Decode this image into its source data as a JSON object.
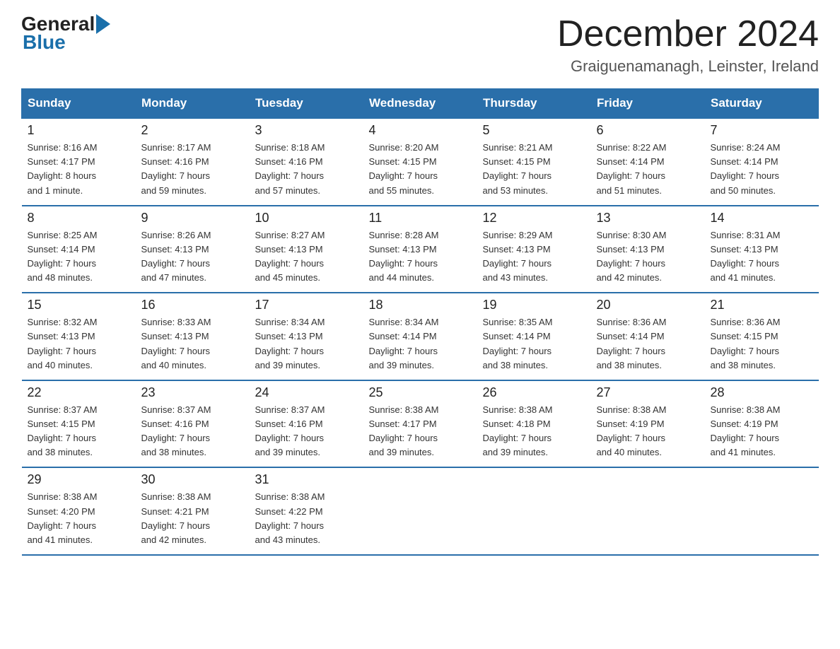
{
  "logo": {
    "general": "General",
    "blue": "Blue",
    "arrow": "▶"
  },
  "title": "December 2024",
  "location": "Graiguenamanagh, Leinster, Ireland",
  "days_of_week": [
    "Sunday",
    "Monday",
    "Tuesday",
    "Wednesday",
    "Thursday",
    "Friday",
    "Saturday"
  ],
  "weeks": [
    [
      {
        "date": "1",
        "sunrise": "8:16 AM",
        "sunset": "4:17 PM",
        "daylight": "8 hours and 1 minute."
      },
      {
        "date": "2",
        "sunrise": "8:17 AM",
        "sunset": "4:16 PM",
        "daylight": "7 hours and 59 minutes."
      },
      {
        "date": "3",
        "sunrise": "8:18 AM",
        "sunset": "4:16 PM",
        "daylight": "7 hours and 57 minutes."
      },
      {
        "date": "4",
        "sunrise": "8:20 AM",
        "sunset": "4:15 PM",
        "daylight": "7 hours and 55 minutes."
      },
      {
        "date": "5",
        "sunrise": "8:21 AM",
        "sunset": "4:15 PM",
        "daylight": "7 hours and 53 minutes."
      },
      {
        "date": "6",
        "sunrise": "8:22 AM",
        "sunset": "4:14 PM",
        "daylight": "7 hours and 51 minutes."
      },
      {
        "date": "7",
        "sunrise": "8:24 AM",
        "sunset": "4:14 PM",
        "daylight": "7 hours and 50 minutes."
      }
    ],
    [
      {
        "date": "8",
        "sunrise": "8:25 AM",
        "sunset": "4:14 PM",
        "daylight": "7 hours and 48 minutes."
      },
      {
        "date": "9",
        "sunrise": "8:26 AM",
        "sunset": "4:13 PM",
        "daylight": "7 hours and 47 minutes."
      },
      {
        "date": "10",
        "sunrise": "8:27 AM",
        "sunset": "4:13 PM",
        "daylight": "7 hours and 45 minutes."
      },
      {
        "date": "11",
        "sunrise": "8:28 AM",
        "sunset": "4:13 PM",
        "daylight": "7 hours and 44 minutes."
      },
      {
        "date": "12",
        "sunrise": "8:29 AM",
        "sunset": "4:13 PM",
        "daylight": "7 hours and 43 minutes."
      },
      {
        "date": "13",
        "sunrise": "8:30 AM",
        "sunset": "4:13 PM",
        "daylight": "7 hours and 42 minutes."
      },
      {
        "date": "14",
        "sunrise": "8:31 AM",
        "sunset": "4:13 PM",
        "daylight": "7 hours and 41 minutes."
      }
    ],
    [
      {
        "date": "15",
        "sunrise": "8:32 AM",
        "sunset": "4:13 PM",
        "daylight": "7 hours and 40 minutes."
      },
      {
        "date": "16",
        "sunrise": "8:33 AM",
        "sunset": "4:13 PM",
        "daylight": "7 hours and 40 minutes."
      },
      {
        "date": "17",
        "sunrise": "8:34 AM",
        "sunset": "4:13 PM",
        "daylight": "7 hours and 39 minutes."
      },
      {
        "date": "18",
        "sunrise": "8:34 AM",
        "sunset": "4:14 PM",
        "daylight": "7 hours and 39 minutes."
      },
      {
        "date": "19",
        "sunrise": "8:35 AM",
        "sunset": "4:14 PM",
        "daylight": "7 hours and 38 minutes."
      },
      {
        "date": "20",
        "sunrise": "8:36 AM",
        "sunset": "4:14 PM",
        "daylight": "7 hours and 38 minutes."
      },
      {
        "date": "21",
        "sunrise": "8:36 AM",
        "sunset": "4:15 PM",
        "daylight": "7 hours and 38 minutes."
      }
    ],
    [
      {
        "date": "22",
        "sunrise": "8:37 AM",
        "sunset": "4:15 PM",
        "daylight": "7 hours and 38 minutes."
      },
      {
        "date": "23",
        "sunrise": "8:37 AM",
        "sunset": "4:16 PM",
        "daylight": "7 hours and 38 minutes."
      },
      {
        "date": "24",
        "sunrise": "8:37 AM",
        "sunset": "4:16 PM",
        "daylight": "7 hours and 39 minutes."
      },
      {
        "date": "25",
        "sunrise": "8:38 AM",
        "sunset": "4:17 PM",
        "daylight": "7 hours and 39 minutes."
      },
      {
        "date": "26",
        "sunrise": "8:38 AM",
        "sunset": "4:18 PM",
        "daylight": "7 hours and 39 minutes."
      },
      {
        "date": "27",
        "sunrise": "8:38 AM",
        "sunset": "4:19 PM",
        "daylight": "7 hours and 40 minutes."
      },
      {
        "date": "28",
        "sunrise": "8:38 AM",
        "sunset": "4:19 PM",
        "daylight": "7 hours and 41 minutes."
      }
    ],
    [
      {
        "date": "29",
        "sunrise": "8:38 AM",
        "sunset": "4:20 PM",
        "daylight": "7 hours and 41 minutes."
      },
      {
        "date": "30",
        "sunrise": "8:38 AM",
        "sunset": "4:21 PM",
        "daylight": "7 hours and 42 minutes."
      },
      {
        "date": "31",
        "sunrise": "8:38 AM",
        "sunset": "4:22 PM",
        "daylight": "7 hours and 43 minutes."
      },
      {
        "date": "",
        "sunrise": "",
        "sunset": "",
        "daylight": ""
      },
      {
        "date": "",
        "sunrise": "",
        "sunset": "",
        "daylight": ""
      },
      {
        "date": "",
        "sunrise": "",
        "sunset": "",
        "daylight": ""
      },
      {
        "date": "",
        "sunrise": "",
        "sunset": "",
        "daylight": ""
      }
    ]
  ],
  "labels": {
    "sunrise_prefix": "Sunrise: ",
    "sunset_prefix": "Sunset: ",
    "daylight_prefix": "Daylight: "
  }
}
